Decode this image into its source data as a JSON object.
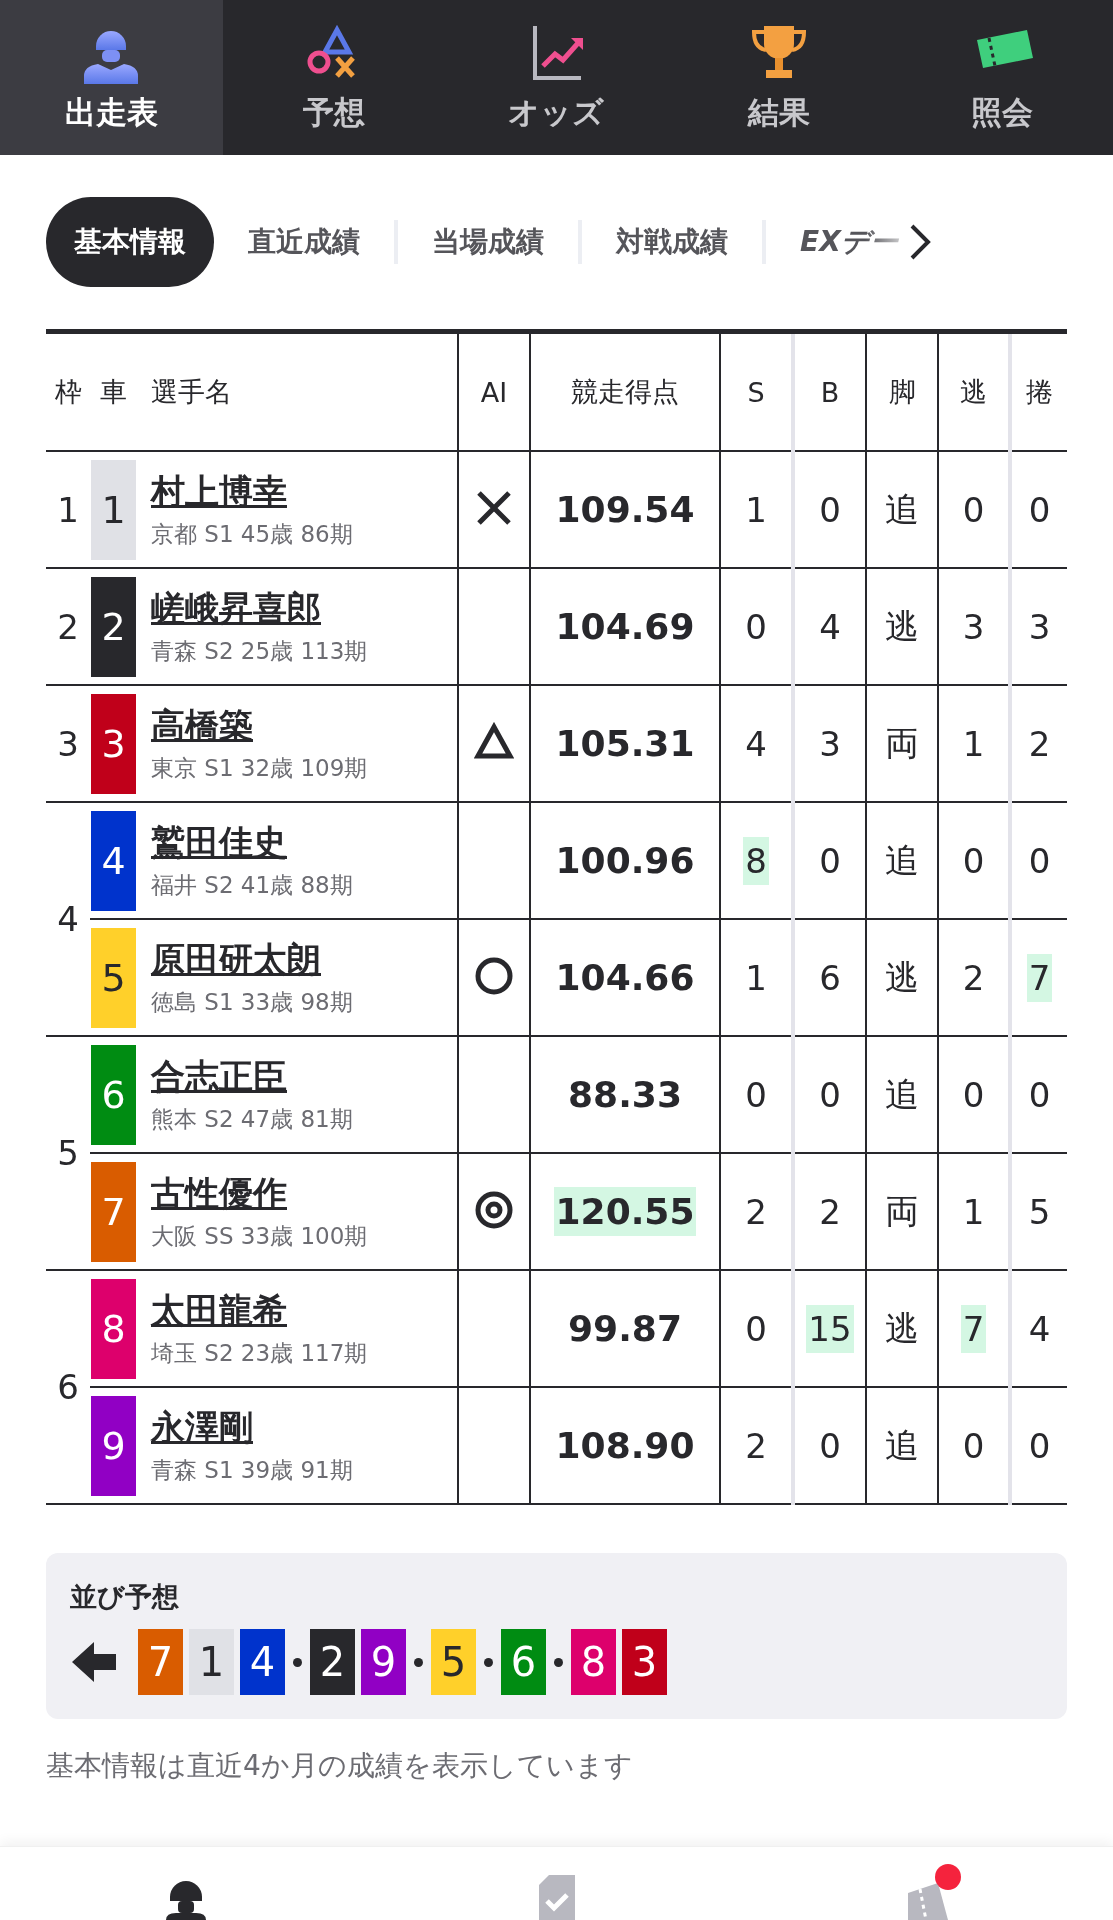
{
  "nav": [
    {
      "label": "出走表",
      "kind": "rider",
      "selected": true
    },
    {
      "label": "予想",
      "kind": "shapes",
      "selected": false
    },
    {
      "label": "オッズ",
      "kind": "chart",
      "selected": false
    },
    {
      "label": "結果",
      "kind": "trophy",
      "selected": false
    },
    {
      "label": "照会",
      "kind": "ticket",
      "selected": false
    }
  ],
  "tabs": [
    {
      "label": "基本情報",
      "selected": true
    },
    {
      "label": "直近成績",
      "selected": false
    },
    {
      "label": "当場成績",
      "selected": false
    },
    {
      "label": "対戦成績",
      "selected": false
    },
    {
      "label": "EXデー",
      "selected": false
    }
  ],
  "table": {
    "columns": [
      "枠",
      "車",
      "選手名",
      "AI",
      "競走得点",
      "S",
      "B",
      "脚",
      "逃",
      "捲"
    ],
    "frames": [
      {
        "number": "1",
        "riders": [
          {
            "car": "1",
            "color": "#e0e1e6",
            "name": "村上博幸",
            "info": "京都 S1 45歳 86期",
            "ai": {
              "kind": "cross"
            },
            "score": {
              "value": "109.54",
              "highlighted": false
            },
            "s": {
              "value": "1",
              "highlighted": false
            },
            "b": {
              "value": "0",
              "highlighted": false
            },
            "leg": "追",
            "nige": {
              "value": "0",
              "highlighted": false
            },
            "makuri": {
              "value": "0",
              "highlighted": false
            }
          }
        ]
      },
      {
        "number": "2",
        "riders": [
          {
            "car": "2",
            "color": "#28282c",
            "name": "嵯峨昇喜郎",
            "info": "青森 S2 25歳 113期",
            "score": {
              "value": "104.69",
              "highlighted": false
            },
            "s": {
              "value": "0",
              "highlighted": false
            },
            "b": {
              "value": "4",
              "highlighted": false
            },
            "leg": "逃",
            "nige": {
              "value": "3",
              "highlighted": false
            },
            "makuri": {
              "value": "3",
              "highlighted": false
            }
          }
        ]
      },
      {
        "number": "3",
        "riders": [
          {
            "car": "3",
            "color": "#c0001a",
            "name": "高橋築",
            "info": "東京 S1 32歳 109期",
            "ai": {
              "kind": "triangle"
            },
            "score": {
              "value": "105.31",
              "highlighted": false
            },
            "s": {
              "value": "4",
              "highlighted": false
            },
            "b": {
              "value": "3",
              "highlighted": false
            },
            "leg": "両",
            "nige": {
              "value": "1",
              "highlighted": false
            },
            "makuri": {
              "value": "2",
              "highlighted": false
            }
          }
        ]
      },
      {
        "number": "4",
        "riders": [
          {
            "car": "4",
            "color": "#0033cc",
            "name": "鷲田佳史",
            "info": "福井 S2 41歳 88期",
            "score": {
              "value": "100.96",
              "highlighted": false
            },
            "s": {
              "value": "8",
              "highlighted": true
            },
            "b": {
              "value": "0",
              "highlighted": false
            },
            "leg": "追",
            "nige": {
              "value": "0",
              "highlighted": false
            },
            "makuri": {
              "value": "0",
              "highlighted": false
            }
          },
          {
            "car": "5",
            "color": "#ffd02a",
            "name": "原田研太朗",
            "info": "徳島 S1 33歳 98期",
            "ai": {
              "kind": "circle"
            },
            "score": {
              "value": "104.66",
              "highlighted": false
            },
            "s": {
              "value": "1",
              "highlighted": false
            },
            "b": {
              "value": "6",
              "highlighted": false
            },
            "leg": "逃",
            "nige": {
              "value": "2",
              "highlighted": false
            },
            "makuri": {
              "value": "7",
              "highlighted": true
            }
          }
        ]
      },
      {
        "number": "5",
        "riders": [
          {
            "car": "6",
            "color": "#008c12",
            "name": "合志正臣",
            "info": "熊本 S2 47歳 81期",
            "score": {
              "value": "88.33",
              "highlighted": false
            },
            "s": {
              "value": "0",
              "highlighted": false
            },
            "b": {
              "value": "0",
              "highlighted": false
            },
            "leg": "追",
            "nige": {
              "value": "0",
              "highlighted": false
            },
            "makuri": {
              "value": "0",
              "highlighted": false
            }
          },
          {
            "car": "7",
            "color": "#d95c00",
            "name": "古性優作",
            "info": "大阪 SS 33歳 100期",
            "ai": {
              "kind": "double-circle"
            },
            "score": {
              "value": "120.55",
              "highlighted": true
            },
            "s": {
              "value": "2",
              "highlighted": false
            },
            "b": {
              "value": "2",
              "highlighted": false
            },
            "leg": "両",
            "nige": {
              "value": "1",
              "highlighted": false
            },
            "makuri": {
              "value": "5",
              "highlighted": false
            }
          }
        ]
      },
      {
        "number": "6",
        "riders": [
          {
            "car": "8",
            "color": "#dd006c",
            "name": "太田龍希",
            "info": "埼玉 S2 23歳 117期",
            "score": {
              "value": "99.87",
              "highlighted": false
            },
            "s": {
              "value": "0",
              "highlighted": false
            },
            "b": {
              "value": "15",
              "highlighted": true
            },
            "leg": "逃",
            "nige": {
              "value": "7",
              "highlighted": true
            },
            "makuri": {
              "value": "4",
              "highlighted": false
            }
          },
          {
            "car": "9",
            "color": "#9100c4",
            "name": "永澤剛",
            "info": "青森 S1 39歳 91期",
            "score": {
              "value": "108.90",
              "highlighted": false
            },
            "s": {
              "value": "2",
              "highlighted": false
            },
            "b": {
              "value": "0",
              "highlighted": false
            },
            "leg": "追",
            "nige": {
              "value": "0",
              "highlighted": false
            },
            "makuri": {
              "value": "0",
              "highlighted": false
            }
          }
        ]
      }
    ]
  },
  "lineup": {
    "title": "並び予想",
    "groups": [
      {
        "cars": [
          {
            "number": "7",
            "color": "#d95c00"
          },
          {
            "number": "1",
            "color": "#e0e1e6"
          },
          {
            "number": "4",
            "color": "#0033cc"
          }
        ]
      },
      {
        "cars": [
          {
            "number": "2",
            "color": "#28282c"
          },
          {
            "number": "9",
            "color": "#9100c4"
          }
        ]
      },
      {
        "cars": [
          {
            "number": "5",
            "color": "#ffd02a"
          }
        ]
      },
      {
        "cars": [
          {
            "number": "6",
            "color": "#008c12"
          }
        ]
      },
      {
        "cars": [
          {
            "number": "8",
            "color": "#dd006c"
          },
          {
            "number": "3",
            "color": "#c0001a"
          }
        ]
      }
    ]
  },
  "note": "基本情報は直近4か月の成績を表示しています",
  "bottom_bar": [
    {
      "kind": "rider",
      "selected": true,
      "badge": false
    },
    {
      "kind": "check",
      "selected": false,
      "badge": false
    },
    {
      "kind": "ticket",
      "selected": false,
      "badge": true
    }
  ]
}
